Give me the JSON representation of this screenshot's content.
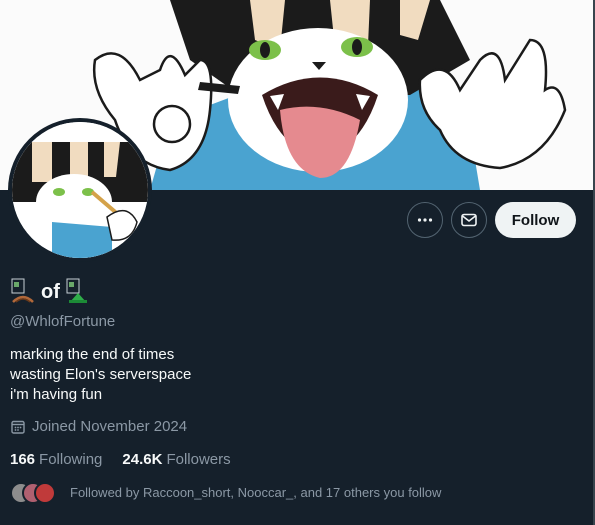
{
  "profile": {
    "name_text": "of",
    "handle": "@WhlofFortune",
    "bio_lines": [
      "marking the end of times",
      "wasting Elon's serverspace",
      "i'm having fun"
    ],
    "joined": "Joined November 2024"
  },
  "stats": {
    "following_count": "166",
    "following_label": "Following",
    "followers_count": "24.6K",
    "followers_label": "Followers"
  },
  "followed_by": "Followed by Raccoon_short, Nooccar_, and 17 others you follow",
  "actions": {
    "follow_label": "Follow"
  },
  "icons": {
    "more": "more-dots-icon",
    "message": "envelope-icon",
    "calendar": "calendar-icon"
  },
  "colors": {
    "background": "#15202b",
    "secondary_text": "#8b98a5",
    "follow_button_bg": "#eff3f4"
  }
}
